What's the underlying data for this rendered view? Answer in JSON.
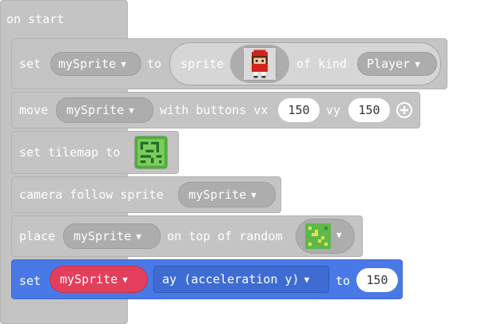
{
  "hat": {
    "label": "on start"
  },
  "blocks": {
    "set_sprite": {
      "set": "set",
      "variable": "mySprite",
      "to": "to",
      "sprite": "sprite",
      "of_kind": "of kind",
      "kind": "Player"
    },
    "move": {
      "move": "move",
      "variable": "mySprite",
      "with_buttons_vx": "with buttons vx",
      "vx": "150",
      "vy_label": "vy",
      "vy": "150"
    },
    "tilemap": {
      "label": "set tilemap to"
    },
    "camera": {
      "label": "camera follow sprite",
      "variable": "mySprite"
    },
    "place": {
      "place": "place",
      "variable": "mySprite",
      "on_top_of_random": "on top of random"
    },
    "set_ay": {
      "set": "set",
      "variable": "mySprite",
      "property": "ay (acceleration y)",
      "to": "to",
      "value": "150"
    }
  },
  "icons": {
    "caret": "▼",
    "add": "plus-circle-icon",
    "player_sprite": "player-sprite-icon",
    "tilemap": "tilemap-icon",
    "tile": "tile-icon"
  },
  "colors": {
    "block_gray": "#c4c4c4",
    "pill_gray": "#adadad",
    "blue_block": "#4979e6",
    "red_variable": "#e33f5c"
  }
}
